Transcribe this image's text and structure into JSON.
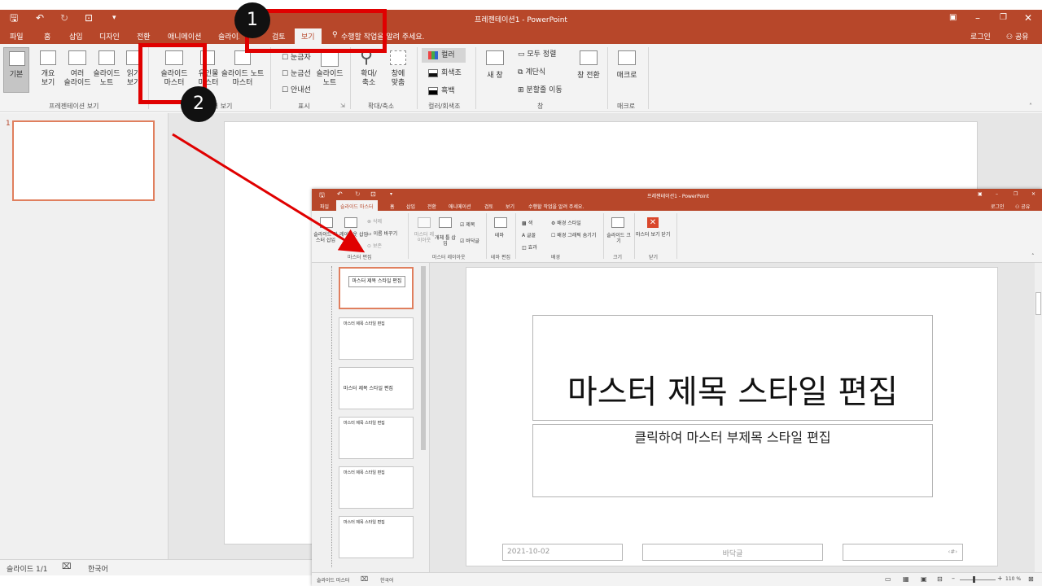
{
  "app": {
    "window_title": "프레젠테이션1 - PowerPoint",
    "user_signin": "로그인",
    "share": "공유"
  },
  "tabs": [
    "파일",
    "홈",
    "삽입",
    "디자인",
    "전환",
    "애니메이션",
    "슬라이드 쇼",
    "검토",
    "보기"
  ],
  "tell_me": "수행할 작업을 알려 주세요.",
  "ribbon": {
    "presentation_views": {
      "group_label": "프레젠테이션 보기",
      "buttons": [
        {
          "line1": "기본",
          "line2": ""
        },
        {
          "line1": "개요",
          "line2": "보기"
        },
        {
          "line1": "여러",
          "line2": "슬라이드"
        },
        {
          "line1": "슬라이드",
          "line2": "노트"
        },
        {
          "line1": "읽기",
          "line2": "보기"
        }
      ]
    },
    "master_views": {
      "group_label": "마스터 보기",
      "buttons": [
        {
          "line1": "슬라이드",
          "line2": "마스터"
        },
        {
          "line1": "유인물",
          "line2": "마스터"
        },
        {
          "line1": "슬라이드 노트",
          "line2": "마스터"
        }
      ]
    },
    "show": {
      "group_label": "표시",
      "checkboxes": [
        "눈금자",
        "눈금선",
        "안내선"
      ],
      "notes_button": {
        "line1": "슬라이드",
        "line2": "노트"
      }
    },
    "zoom": {
      "group_label": "확대/축소",
      "buttons": [
        {
          "line1": "확대/",
          "line2": "축소"
        },
        {
          "line1": "창에",
          "line2": "맞춤"
        }
      ]
    },
    "color": {
      "group_label": "컬러/회색조",
      "options": [
        "컬러",
        "회색조",
        "흑백"
      ]
    },
    "window": {
      "group_label": "창",
      "new_window": "새 창",
      "items": [
        "모두 정렬",
        "계단식",
        "분할줄 이동"
      ],
      "switch": "창 전환"
    },
    "macros": {
      "group_label": "매크로",
      "button": "매크로"
    }
  },
  "thumbnail_number": "1",
  "status": {
    "slide_count": "슬라이드 1/1",
    "language": "한국어"
  },
  "annotations": {
    "badge1": "1",
    "badge2": "2"
  },
  "inset": {
    "window_title": "프레젠테이션1 - PowerPoint",
    "user_signin": "로그인",
    "share": "공유",
    "tabs": [
      "파일",
      "슬라이드 마스터",
      "홈",
      "삽입",
      "전환",
      "애니메이션",
      "검토",
      "보기"
    ],
    "tell_me": "수행할 작업을 알려 주세요.",
    "ribbon": {
      "edit_master": {
        "group_label": "마스터 편집",
        "insert_master": "슬라이드 마스터 삽입",
        "insert_layout": "레이아웃 삽입",
        "delete": "삭제",
        "rename": "이름 바꾸기",
        "preserve": "보존"
      },
      "master_layout": {
        "group_label": "마스터 레이아웃",
        "master_layout_btn": "마스터 레이아웃",
        "insert_placeholder": "개체 틀 삽입",
        "title": "제목",
        "footers": "바닥글"
      },
      "edit_theme": {
        "group_label": "테마 편집",
        "theme": "테마"
      },
      "background": {
        "group_label": "배경",
        "colors": "색",
        "fonts": "글꼴",
        "effects": "효과",
        "bg_styles": "배경 스타일",
        "hide_bg": "배경 그래픽 숨기기"
      },
      "size": {
        "group_label": "크기",
        "slide_size": "슬라이드 크기"
      },
      "close": {
        "group_label": "닫기",
        "close_btn": "마스터 보기 닫기"
      }
    },
    "thumb_title": "마스터 제목 스타일 편집",
    "slide": {
      "title": "마스터 제목 스타일 편집",
      "subtitle": "클릭하여 마스터 부제목 스타일 편집",
      "date": "2021-10-02",
      "footer": "바닥글",
      "page": "‹#›"
    },
    "status": {
      "view": "슬라이드 마스터",
      "language": "한국어",
      "zoom": "110 %"
    }
  },
  "colors": {
    "accent": "#b7472a",
    "annotation": "#e00000"
  }
}
